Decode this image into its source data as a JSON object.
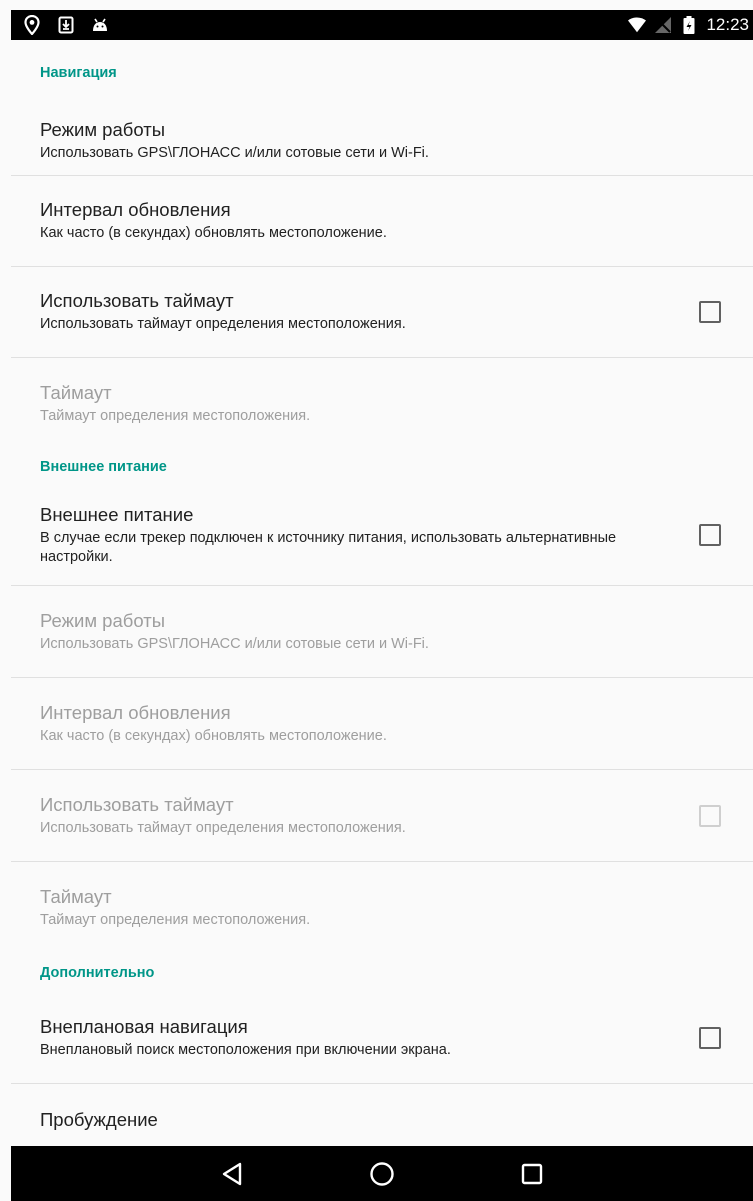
{
  "status_bar": {
    "time": "12:23",
    "icons": [
      "location-pin-icon",
      "download-icon",
      "android-icon",
      "wifi-icon",
      "no-sim-icon",
      "battery-icon"
    ]
  },
  "sections": [
    {
      "header": "Навигация"
    },
    {
      "header": "Внешнее питание"
    },
    {
      "header": "Дополнительно"
    }
  ],
  "prefs": [
    {
      "title": "Режим работы",
      "summary": "Использовать GPS\\ГЛОНАСС и/или сотовые сети и Wi-Fi."
    },
    {
      "title": "Интервал обновления",
      "summary": "Как часто (в секундах) обновлять местоположение."
    },
    {
      "title": "Использовать таймаут",
      "summary": "Использовать таймаут определения местоположения.",
      "checked": false
    },
    {
      "title": "Таймаут",
      "summary": "Таймаут определения местоположения.",
      "enabled": false
    },
    {
      "title": "Внешнее питание",
      "summary": "В случае если трекер подключен к источнику питания, использовать альтернативные настройки.",
      "checked": false
    },
    {
      "title": "Режим работы",
      "summary": "Использовать GPS\\ГЛОНАСС и/или сотовые сети и Wi-Fi.",
      "enabled": false
    },
    {
      "title": "Интервал обновления",
      "summary": "Как часто (в секундах) обновлять местоположение.",
      "enabled": false
    },
    {
      "title": "Использовать таймаут",
      "summary": "Использовать таймаут определения местоположения.",
      "enabled": false,
      "checked": false
    },
    {
      "title": "Таймаут",
      "summary": "Таймаут определения местоположения.",
      "enabled": false
    },
    {
      "title": "Внеплановая навигация",
      "summary": "Внеплановый поиск местоположения при включении экрана.",
      "checked": false
    },
    {
      "title": "Пробуждение"
    }
  ],
  "nav_bar": {
    "icons": [
      "back-icon",
      "home-icon",
      "recents-icon"
    ]
  },
  "colors": {
    "accent": "#009688",
    "text_primary": "#212121",
    "text_disabled": "#9e9e9e",
    "background": "#fafafa",
    "divider": "#e0e0e0"
  }
}
